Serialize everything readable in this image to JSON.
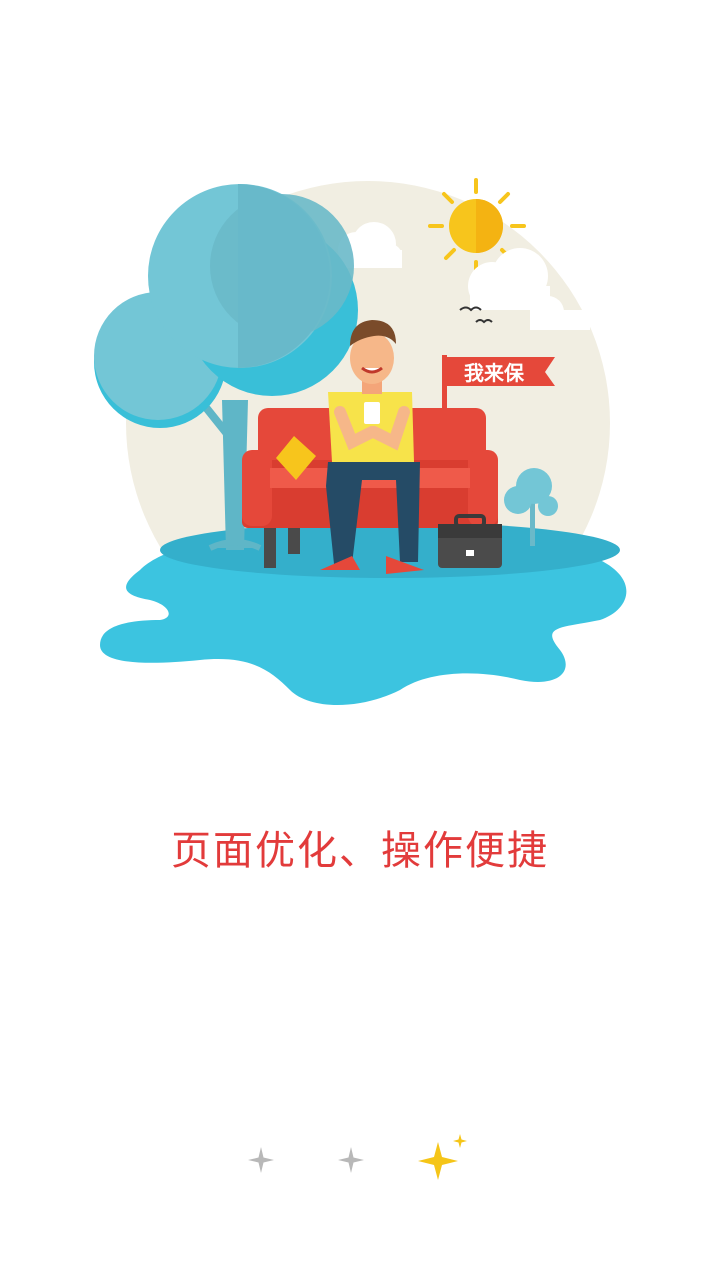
{
  "illustration": {
    "flag_text": "我来保"
  },
  "slogan": "页面优化、操作便捷",
  "pager": {
    "pages": 3,
    "current": 3
  },
  "colors": {
    "slogan": "#e23b3b",
    "inactive_dot": "#b8b8b8",
    "active_dot": "#f5c518",
    "water": "#3cc4e0",
    "sofa": "#e5483a",
    "tree": "#73c6d6",
    "backdrop": "#f1eee2",
    "sun": "#f7c51c"
  }
}
